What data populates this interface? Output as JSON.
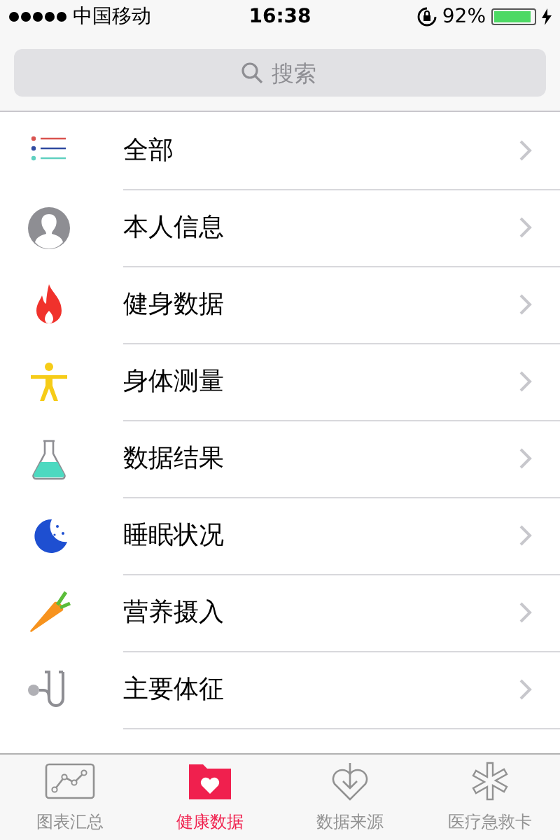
{
  "status_bar": {
    "carrier": "中国移动",
    "time": "16:38",
    "battery": "92%",
    "battery_charge": {
      "level": 0.92
    }
  },
  "search": {
    "placeholder": "搜索"
  },
  "categories": [
    {
      "kind": "list",
      "label": "全部"
    },
    {
      "kind": "person",
      "label": "本人信息"
    },
    {
      "kind": "flame",
      "label": "健身数据"
    },
    {
      "kind": "body",
      "label": "身体测量"
    },
    {
      "kind": "flask",
      "label": "数据结果"
    },
    {
      "kind": "moon",
      "label": "睡眠状况"
    },
    {
      "kind": "carrot",
      "label": "营养摄入"
    },
    {
      "kind": "stethoscope",
      "label": "主要体征"
    }
  ],
  "tabs": [
    {
      "kind": "chart",
      "label": "图表汇总",
      "selected": false
    },
    {
      "kind": "folder",
      "label": "健康数据",
      "selected": true
    },
    {
      "kind": "download",
      "label": "数据来源",
      "selected": false
    },
    {
      "kind": "asterisk",
      "label": "医疗急救卡",
      "selected": false
    }
  ]
}
